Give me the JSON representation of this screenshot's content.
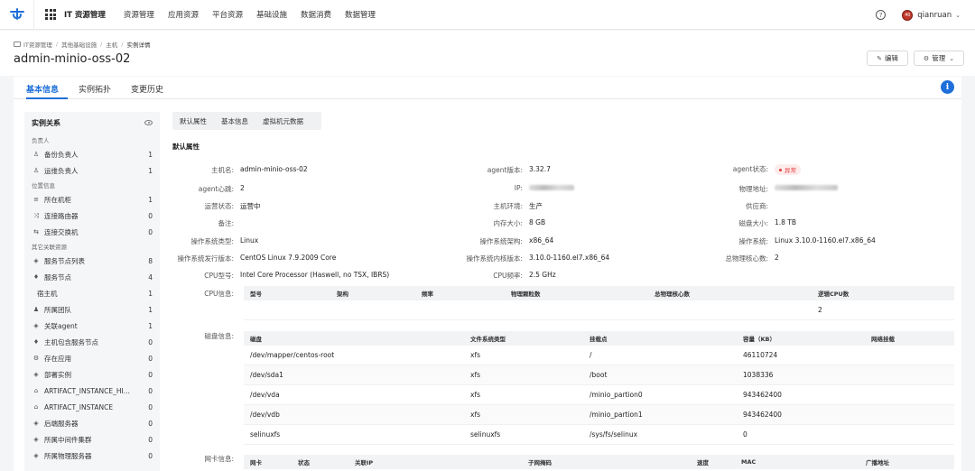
{
  "topnav": {
    "app_title": "IT 资源管理",
    "items": [
      "资源管理",
      "应用资源",
      "平台资源",
      "基础设施",
      "数据消费",
      "数据管理"
    ],
    "help_label": "?",
    "avatar_text": "40",
    "username": "qianruan",
    "caret": "⌄"
  },
  "breadcrumb": [
    "IT资源管理",
    "其他基础设施",
    "主机",
    "实例详情"
  ],
  "page": {
    "title": "admin-minio-oss-02",
    "edit_label": "编辑",
    "manage_label": "管理"
  },
  "tabs": [
    "基本信息",
    "实例拓扑",
    "变更历史"
  ],
  "sidebar": {
    "title": "实例关系",
    "groups": [
      {
        "label": "负责人",
        "items": [
          {
            "icon": "user-icon",
            "glyph": "♙",
            "label": "备份负责人",
            "count": "1"
          },
          {
            "icon": "user-icon",
            "glyph": "♙",
            "label": "运维负责人",
            "count": "1"
          }
        ]
      },
      {
        "label": "位置信息",
        "items": [
          {
            "icon": "rack-icon",
            "glyph": "≡",
            "label": "所在机柜",
            "count": "1"
          },
          {
            "icon": "router-icon",
            "glyph": "⤨",
            "label": "连接路由器",
            "count": "0"
          },
          {
            "icon": "switch-icon",
            "glyph": "⇆",
            "label": "连接交换机",
            "count": "0"
          }
        ]
      },
      {
        "label": "其它关联资源",
        "items": [
          {
            "icon": "cube-icon",
            "glyph": "◈",
            "label": "服务节点列表",
            "count": "8"
          },
          {
            "icon": "pin-icon",
            "glyph": "♦",
            "label": "服务节点",
            "count": "4"
          },
          {
            "icon": "",
            "glyph": "",
            "label": "宿主机",
            "count": "1",
            "sub": true
          },
          {
            "icon": "team-icon",
            "glyph": "♟",
            "label": "所属团队",
            "count": "1"
          },
          {
            "icon": "cube-icon",
            "glyph": "◈",
            "label": "关联agent",
            "count": "1"
          },
          {
            "icon": "pin-icon",
            "glyph": "♦",
            "label": "主机包含服务节点",
            "count": "0"
          },
          {
            "icon": "gear-icon",
            "glyph": "⚙",
            "label": "存在应用",
            "count": "0"
          },
          {
            "icon": "cube-icon",
            "glyph": "◈",
            "label": "部署实例",
            "count": "0"
          },
          {
            "icon": "artifact-icon",
            "glyph": "⌂",
            "label": "ARTIFACT_INSTANCE_HI...",
            "count": "0"
          },
          {
            "icon": "artifact-icon",
            "glyph": "⌂",
            "label": "ARTIFACT_INSTANCE",
            "count": "0"
          },
          {
            "icon": "cube-icon",
            "glyph": "◈",
            "label": "后端服务器",
            "count": "0"
          },
          {
            "icon": "cube-icon",
            "glyph": "◈",
            "label": "所属中间件集群",
            "count": "0"
          },
          {
            "icon": "cube-icon",
            "glyph": "◈",
            "label": "所属物理服务器",
            "count": "0"
          }
        ]
      }
    ]
  },
  "subtabs": [
    "默认属性",
    "基本信息",
    "虚拟机元数据"
  ],
  "section_title": "默认属性",
  "attrs": {
    "hostname": {
      "k": "主机名:",
      "v": "admin-minio-oss-02"
    },
    "agent_version": {
      "k": "agent版本:",
      "v": "3.32.7"
    },
    "agent_status": {
      "k": "agent状态:",
      "v": "异常"
    },
    "agent_heartbeat": {
      "k": "agent心跳:",
      "v": "2"
    },
    "ip": {
      "k": "IP:",
      "v": "***"
    },
    "physical_addr": {
      "k": "物理地址:",
      "v": "***"
    },
    "ops_status": {
      "k": "运营状态:",
      "v": "运营中"
    },
    "host_env": {
      "k": "主机环境:",
      "v": "生产"
    },
    "vendor": {
      "k": "供应商:",
      "v": ""
    },
    "remark": {
      "k": "备注:",
      "v": ""
    },
    "memory": {
      "k": "内存大小:",
      "v": "8 GB"
    },
    "disk": {
      "k": "磁盘大小:",
      "v": "1.8 TB"
    },
    "os_type": {
      "k": "操作系统类型:",
      "v": "Linux"
    },
    "os_arch": {
      "k": "操作系统架构:",
      "v": "x86_64"
    },
    "os": {
      "k": "操作系统:",
      "v": "Linux 3.10.0-1160.el7.x86_64"
    },
    "os_release": {
      "k": "操作系统发行版本:",
      "v": "CentOS Linux 7.9.2009 Core"
    },
    "os_kernel": {
      "k": "操作系统内核版本:",
      "v": "3.10.0-1160.el7.x86_64"
    },
    "cpu_cores": {
      "k": "总物理核心数:",
      "v": "2"
    },
    "cpu_model": {
      "k": "CPU型号:",
      "v": "Intel Core Processor (Haswell, no TSX, IBRS)"
    },
    "cpu_freq": {
      "k": "CPU频率:",
      "v": "2.5 GHz"
    }
  },
  "cpu_table": {
    "label": "CPU信息:",
    "headers": [
      "型号",
      "架构",
      "频率",
      "物理颗粒数",
      "总物理核心数",
      "逻辑CPU数"
    ],
    "rows": [
      [
        "",
        "",
        "",
        "",
        "",
        "2"
      ]
    ]
  },
  "disk_table": {
    "label": "磁盘信息:",
    "headers": [
      "磁盘",
      "文件系统类型",
      "挂载点",
      "容量（KB）",
      "网络挂载"
    ],
    "rows": [
      [
        "/dev/mapper/centos-root",
        "xfs",
        "/",
        "46110724",
        ""
      ],
      [
        "/dev/sda1",
        "xfs",
        "/boot",
        "1038336",
        ""
      ],
      [
        "/dev/vda",
        "xfs",
        "/minio_partion0",
        "943462400",
        ""
      ],
      [
        "/dev/vdb",
        "xfs",
        "/minio_partion1",
        "943462400",
        ""
      ],
      [
        "selinuxfs",
        "selinuxfs",
        "/sys/fs/selinux",
        "0",
        ""
      ]
    ]
  },
  "nic_table": {
    "label": "网卡信息:",
    "headers": [
      "网卡",
      "状态",
      "关联IP",
      "子网掩码",
      "速度",
      "MAC",
      "广播地址"
    ]
  },
  "colors": {
    "accent": "#1e6fd9",
    "danger": "#e23b3b"
  }
}
